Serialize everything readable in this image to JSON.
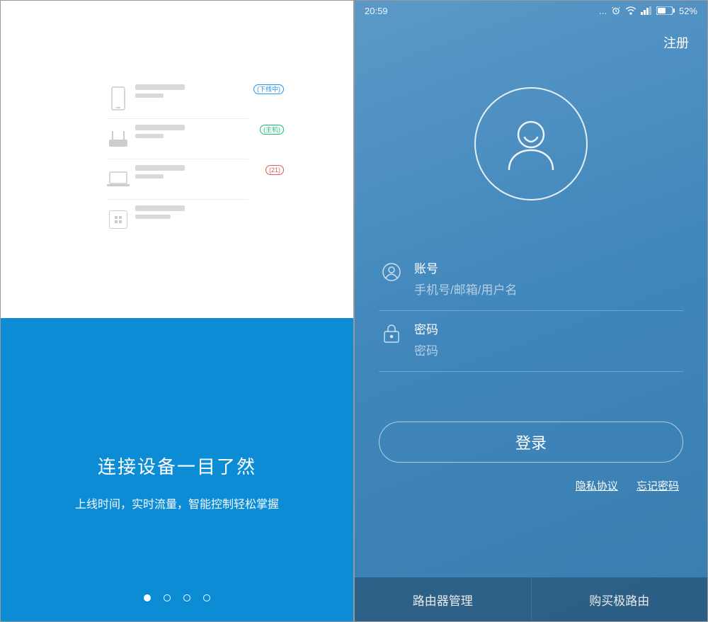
{
  "onboarding": {
    "title": "连接设备一目了然",
    "subtitle": "上线时间，实时流量，智能控制轻松掌握",
    "device_tags": {
      "phone": "(下线中)",
      "router": "(主机)",
      "laptop": "(21)"
    },
    "page_index": 0,
    "page_count": 4
  },
  "statusbar": {
    "time": "20:59",
    "battery": "52%"
  },
  "login": {
    "register": "注册",
    "account_label": "账号",
    "account_placeholder": "手机号/邮箱/用户名",
    "password_label": "密码",
    "password_placeholder": "密码",
    "login_button": "登录",
    "privacy": "隐私协议",
    "forgot": "忘记密码"
  },
  "bottombar": {
    "manage": "路由器管理",
    "buy": "购买极路由"
  }
}
